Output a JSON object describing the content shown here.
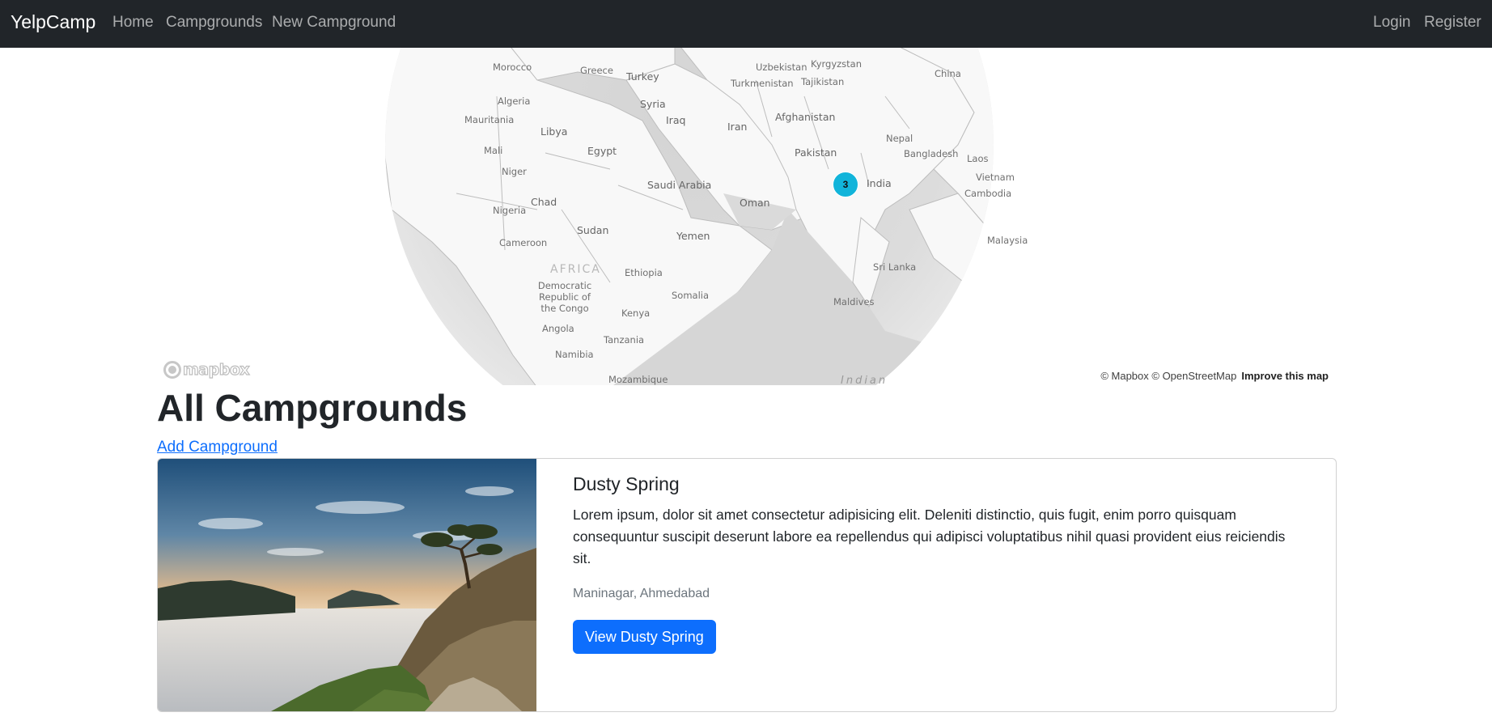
{
  "navbar": {
    "brand": "YelpCamp",
    "links": [
      "Home",
      "Campgrounds",
      "New Campground"
    ],
    "auth_links": [
      "Login",
      "Register"
    ],
    "background": "#212529"
  },
  "map": {
    "labels": {
      "morocco": "Morocco",
      "greece": "Greece",
      "turkey": "Turkey",
      "uzbekistan": "Uzbekistan",
      "kyrgyzstan": "Kyrgyzstan",
      "china": "China",
      "algeria": "Algeria",
      "turkmenistan": "Turkmenistan",
      "tajikistan": "Tajikistan",
      "syria": "Syria",
      "mauritania": "Mauritania",
      "libya": "Libya",
      "iraq": "Iraq",
      "iran": "Iran",
      "afghanistan": "Afghanistan",
      "nepal": "Nepal",
      "mali": "Mali",
      "egypt": "Egypt",
      "pakistan": "Pakistan",
      "bangladesh": "Bangladesh",
      "laos": "Laos",
      "niger": "Niger",
      "saudi_arabia": "Saudi Arabia",
      "india": "India",
      "vietnam": "Vietnam",
      "chad": "Chad",
      "oman": "Oman",
      "cambodia": "Cambodia",
      "nigeria": "Nigeria",
      "sudan": "Sudan",
      "yemen": "Yemen",
      "cameroon": "Cameroon",
      "malaysia": "Malaysia",
      "africa": "AFRICA",
      "sri_lanka": "Sri Lanka",
      "ethiopia": "Ethiopia",
      "drc": "Democratic Republic of the Congo",
      "somalia": "Somalia",
      "maldives": "Maldives",
      "kenya": "Kenya",
      "angola": "Angola",
      "tanzania": "Tanzania",
      "namibia": "Namibia",
      "mozambique": "Mozambique",
      "indian": "Indian"
    },
    "cluster_count": "3",
    "cluster_color": "#11b4da",
    "logo_text": "mapbox",
    "attribution": "© Mapbox © OpenStreetMap",
    "improve_link": "Improve this map"
  },
  "main": {
    "title": "All Campgrounds",
    "add_link": "Add Campground"
  },
  "campgrounds": [
    {
      "title": "Dusty Spring",
      "description": "Lorem ipsum, dolor sit amet consectetur adipisicing elit. Deleniti distinctio, quis fugit, enim porro quisquam consequuntur suscipit deserunt labore ea repellendus qui adipisci voluptatibus nihil quasi provident eius reiciendis sit.",
      "location": "Maninagar, Ahmedabad",
      "button": "View Dusty Spring"
    }
  ],
  "colors": {
    "primary": "#0d6efd",
    "muted": "#6c757d"
  }
}
